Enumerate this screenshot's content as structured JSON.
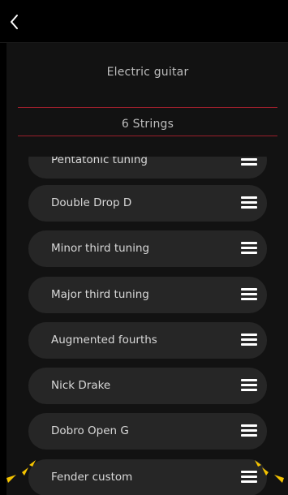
{
  "header": {
    "back_icon": "chevron-left-icon"
  },
  "instrument": {
    "value": "Electric guitar"
  },
  "strings": {
    "value": "6 Strings"
  },
  "tunings": [
    "Pentatonic tuning",
    "Double Drop D",
    "Minor third tuning",
    "Major third tuning",
    "Augmented fourths",
    "Nick Drake",
    "Dobro Open G",
    "Fender custom"
  ],
  "colors": {
    "background": "#000000",
    "panel": "#121212",
    "item": "#262626",
    "divider_accent": "#9b1f2c",
    "highlight": "#f5c400"
  }
}
